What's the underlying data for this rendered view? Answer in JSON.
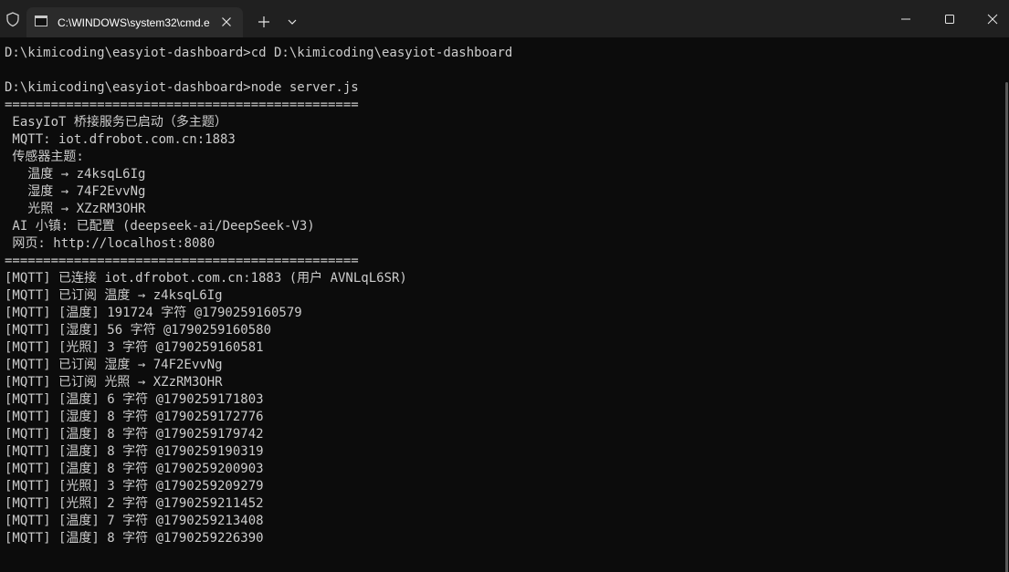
{
  "tab": {
    "title": "C:\\WINDOWS\\system32\\cmd.e",
    "icon": "cmd-icon"
  },
  "titlebar": {
    "shield_icon": "shield-icon",
    "close_tab_icon": "close-icon",
    "new_tab_icon": "plus-icon",
    "dropdown_icon": "chevron-down-icon",
    "minimize_icon": "minimize-icon",
    "maximize_icon": "maximize-icon",
    "close_window_icon": "close-icon"
  },
  "colors": {
    "terminal_bg": "#0c0c0c",
    "terminal_fg": "#cccccc",
    "titlebar_bg": "#202020",
    "tab_bg": "#2b2b2b"
  },
  "terminal": {
    "lines": [
      "D:\\kimicoding\\easyiot-dashboard>cd D:\\kimicoding\\easyiot-dashboard",
      "",
      "D:\\kimicoding\\easyiot-dashboard>node server.js",
      "==============================================",
      " EasyIoT 桥接服务已启动（多主题）",
      " MQTT: iot.dfrobot.com.cn:1883",
      " 传感器主题:",
      "   温度 → z4ksqL6Ig",
      "   湿度 → 74F2EvvNg",
      "   光照 → XZzRM3OHR",
      " AI 小镇: 已配置 (deepseek-ai/DeepSeek-V3)",
      " 网页: http://localhost:8080",
      "==============================================",
      "[MQTT] 已连接 iot.dfrobot.com.cn:1883 (用户 AVNLqL6SR)",
      "[MQTT] 已订阅 温度 → z4ksqL6Ig",
      "[MQTT] [温度] 191724 字符 @1790259160579",
      "[MQTT] [湿度] 56 字符 @1790259160580",
      "[MQTT] [光照] 3 字符 @1790259160581",
      "[MQTT] 已订阅 湿度 → 74F2EvvNg",
      "[MQTT] 已订阅 光照 → XZzRM3OHR",
      "[MQTT] [温度] 6 字符 @1790259171803",
      "[MQTT] [湿度] 8 字符 @1790259172776",
      "[MQTT] [温度] 8 字符 @1790259179742",
      "[MQTT] [温度] 8 字符 @1790259190319",
      "[MQTT] [温度] 8 字符 @1790259200903",
      "[MQTT] [光照] 3 字符 @1790259209279",
      "[MQTT] [光照] 2 字符 @1790259211452",
      "[MQTT] [温度] 7 字符 @1790259213408",
      "[MQTT] [温度] 8 字符 @1790259226390"
    ]
  }
}
